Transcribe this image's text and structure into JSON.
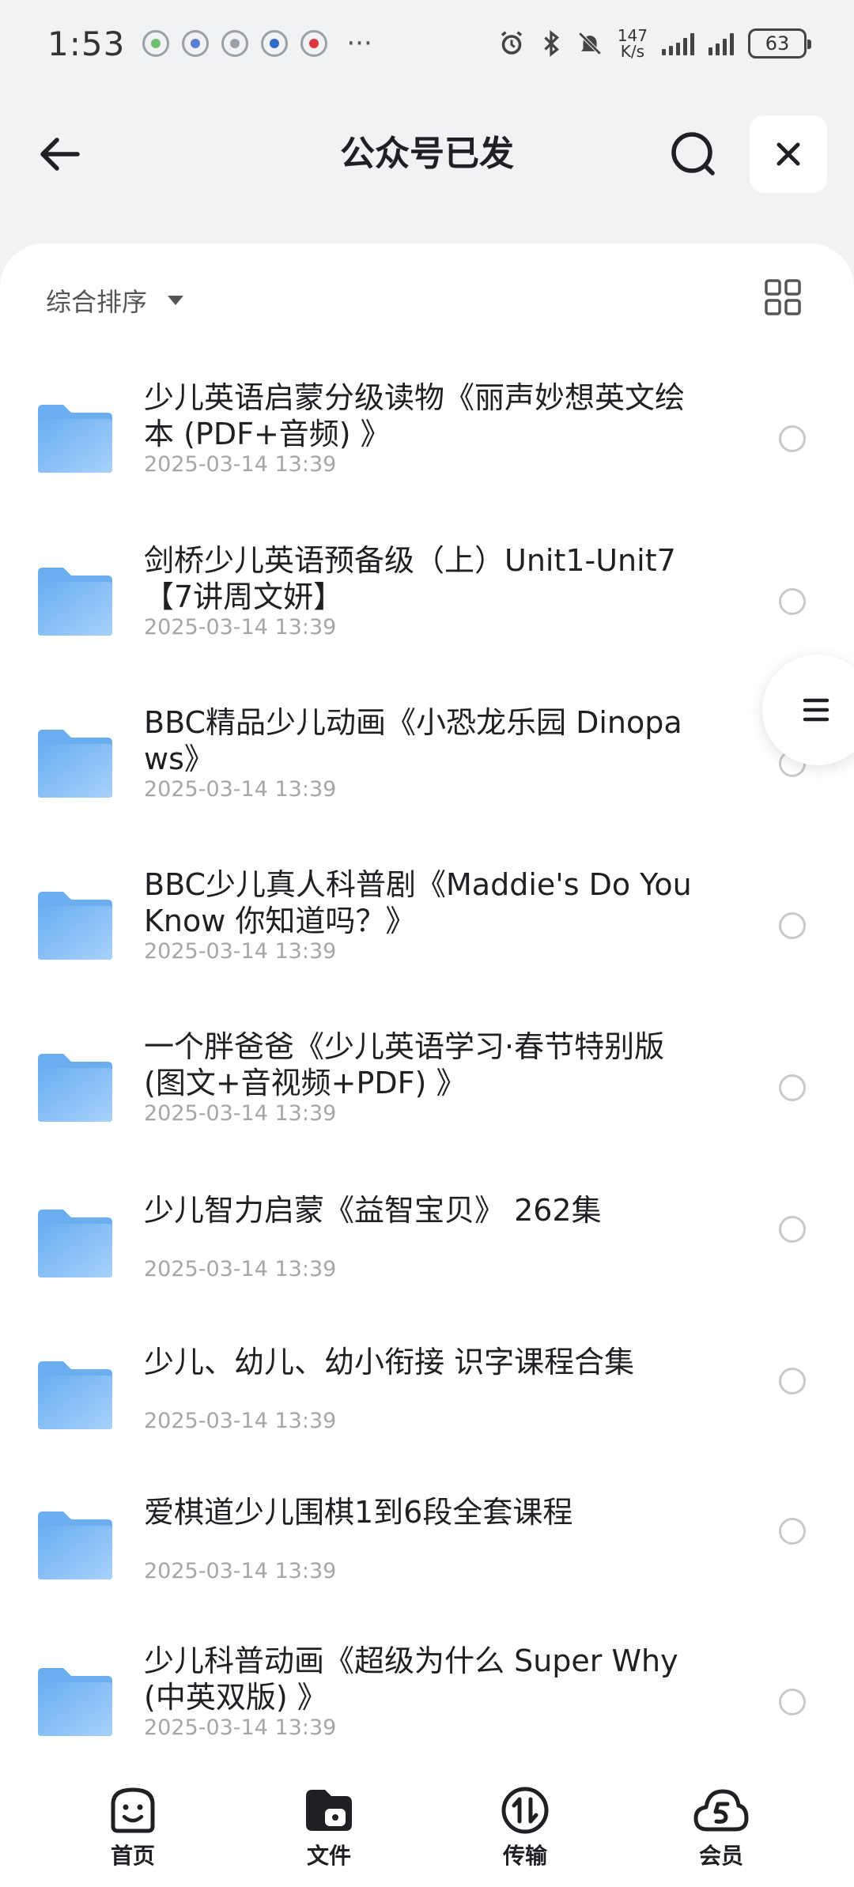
{
  "status": {
    "time": "1:53",
    "more": "···",
    "net_speed_value": "147",
    "net_speed_unit": "K/s",
    "battery": "63",
    "app_dot_colors": [
      "#6fbf73",
      "#5a7fd6",
      "#9aa0a8",
      "#2f6cc7",
      "#d9363e"
    ]
  },
  "header": {
    "title": "公众号已发"
  },
  "toolbar": {
    "sort_label": "综合排序"
  },
  "files": [
    {
      "name": "少儿英语启蒙分级读物《丽声妙想英文绘本 (PDF+音频) 》",
      "date": "2025-03-14 13:39"
    },
    {
      "name": "剑桥少儿英语预备级（上）Unit1-Unit7 【7讲周文妍】",
      "date": "2025-03-14 13:39"
    },
    {
      "name": "BBC精品少儿动画《小恐龙乐园 Dinopaws》",
      "date": "2025-03-14 13:39"
    },
    {
      "name": "BBC少儿真人科普剧《Maddie's Do You Know 你知道吗？》",
      "date": "2025-03-14 13:39"
    },
    {
      "name": "一个胖爸爸《少儿英语学习·春节特别版 (图文+音视频+PDF) 》",
      "date": "2025-03-14 13:39"
    },
    {
      "name": "少儿智力启蒙《益智宝贝》 262集",
      "date": "2025-03-14 13:39"
    },
    {
      "name": "少儿、幼儿、幼小衔接 识字课程合集",
      "date": "2025-03-14 13:39"
    },
    {
      "name": "爱棋道少儿围棋1到6段全套课程",
      "date": "2025-03-14 13:39"
    },
    {
      "name": "少儿科普动画《超级为什么 Super Why (中英双版) 》",
      "date": "2025-03-14 13:39"
    }
  ],
  "nav": [
    {
      "label": "首页",
      "icon": "home-smile-icon"
    },
    {
      "label": "文件",
      "icon": "file-folder-icon"
    },
    {
      "label": "传输",
      "icon": "transfer-icon"
    },
    {
      "label": "会员",
      "icon": "vip-cloud-icon"
    }
  ],
  "colors": {
    "background": "#f2f2f4",
    "folder": "#6aaef0",
    "folder_light": "#a7d1fb",
    "date": "#a5a5aa",
    "radio": "#c9c9cd"
  }
}
